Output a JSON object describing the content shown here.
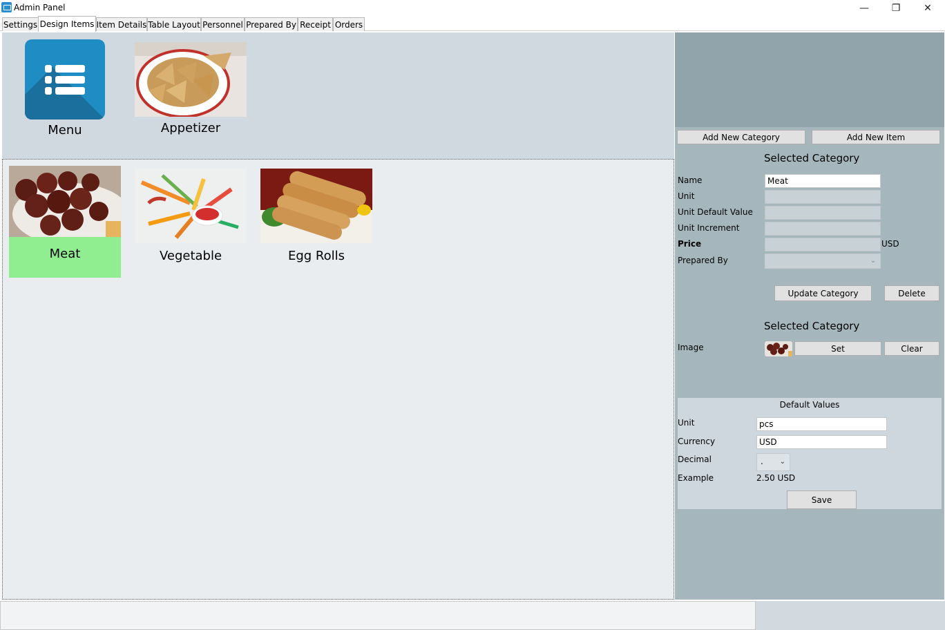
{
  "window": {
    "title": "Admin Panel",
    "minimize": "—",
    "restore": "❐",
    "close": "✕"
  },
  "tabs": [
    {
      "label": "Settings"
    },
    {
      "label": "Design Items"
    },
    {
      "label": "Item Details"
    },
    {
      "label": "Table Layout"
    },
    {
      "label": "Personnel"
    },
    {
      "label": "Prepared By"
    },
    {
      "label": "Receipt"
    },
    {
      "label": "Orders"
    }
  ],
  "categories": {
    "menu": "Menu",
    "appetizer": "Appetizer"
  },
  "items": {
    "meat": "Meat",
    "vegetable": "Vegetable",
    "egg_rolls": "Egg Rolls"
  },
  "colors": {
    "selected": "#90ee90",
    "accent": "#1f8dc4"
  },
  "panel": {
    "add_category": "Add New Category",
    "add_item": "Add New Item",
    "selected_category_title": "Selected Category",
    "name_label": "Name",
    "name_value": "Meat",
    "unit_label": "Unit",
    "unit_default_label": "Unit Default Value",
    "unit_increment_label": "Unit Increment",
    "price_label": "Price",
    "price_currency": "USD",
    "prepared_by_label": "Prepared By",
    "update_category": "Update Category",
    "delete": "Delete",
    "selected_category_title_2": "Selected Category",
    "image_label": "Image",
    "set": "Set",
    "clear": "Clear"
  },
  "defaults": {
    "title": "Default Values",
    "unit_label": "Unit",
    "unit_value": "pcs",
    "currency_label": "Currency",
    "currency_value": "USD",
    "decimal_label": "Decimal",
    "decimal_value": ".",
    "example_label": "Example",
    "example_value": "2.50 USD",
    "save": "Save"
  }
}
